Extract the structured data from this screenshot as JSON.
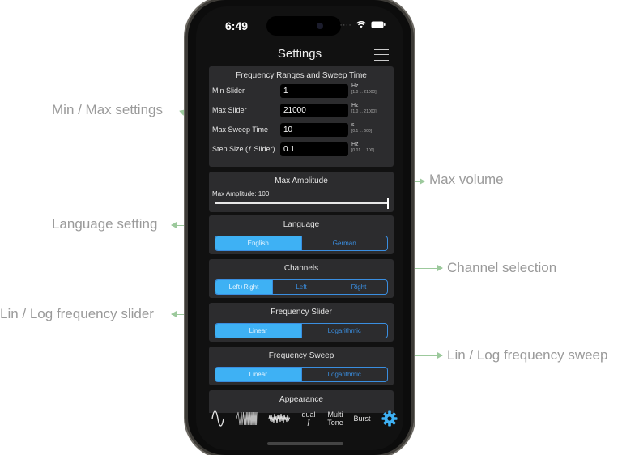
{
  "annotations": {
    "min_max": "Min / Max settings",
    "max_volume": "Max volume",
    "language": "Language setting",
    "channel": "Channel selection",
    "lin_log_slider": "Lin / Log frequency slider",
    "lin_log_sweep": "Lin / Log frequency sweep"
  },
  "status": {
    "time": "6:49",
    "icons": "····  wifi  battery"
  },
  "nav": {
    "title": "Settings"
  },
  "freq": {
    "title": "Frequency Ranges and Sweep Time",
    "rows": [
      {
        "label": "Min Slider",
        "value": "1",
        "unit": "Hz",
        "range": "[1.0 ... 21000]"
      },
      {
        "label": "Max Slider",
        "value": "21000",
        "unit": "Hz",
        "range": "[1.0 ... 21000]"
      },
      {
        "label": "Max Sweep Time",
        "value": "10",
        "unit": "s",
        "range": "[0.1 ... 600]"
      },
      {
        "label": "Step Size (ƒ Slider)",
        "value": "0.1",
        "unit": "Hz",
        "range": "[0.01 ... 100]"
      }
    ]
  },
  "amp": {
    "title": "Max Amplitude",
    "label": "Max Amplitude: 100",
    "value": 100,
    "max": 100
  },
  "language": {
    "title": "Language",
    "options": [
      "English",
      "German"
    ],
    "selected": "English"
  },
  "channels": {
    "title": "Channels",
    "options": [
      "Left+Right",
      "Left",
      "Right"
    ],
    "selected": "Left+Right"
  },
  "slider": {
    "title": "Frequency Slider",
    "options": [
      "Linear",
      "Logarithmic"
    ],
    "selected": "Linear"
  },
  "sweep": {
    "title": "Frequency Sweep",
    "options": [
      "Linear",
      "Logarithmic"
    ],
    "selected": "Linear"
  },
  "appearance": {
    "title": "Appearance"
  },
  "tabs": {
    "dual": "dual",
    "dual_f": "ƒ",
    "multi": "Multi",
    "multi2": "Tone",
    "burst": "Burst"
  },
  "colors": {
    "accent": "#3eb1f4",
    "card": "#2c2c2e",
    "annotation": "#9a9a9a",
    "arrow": "#9cc99c"
  }
}
